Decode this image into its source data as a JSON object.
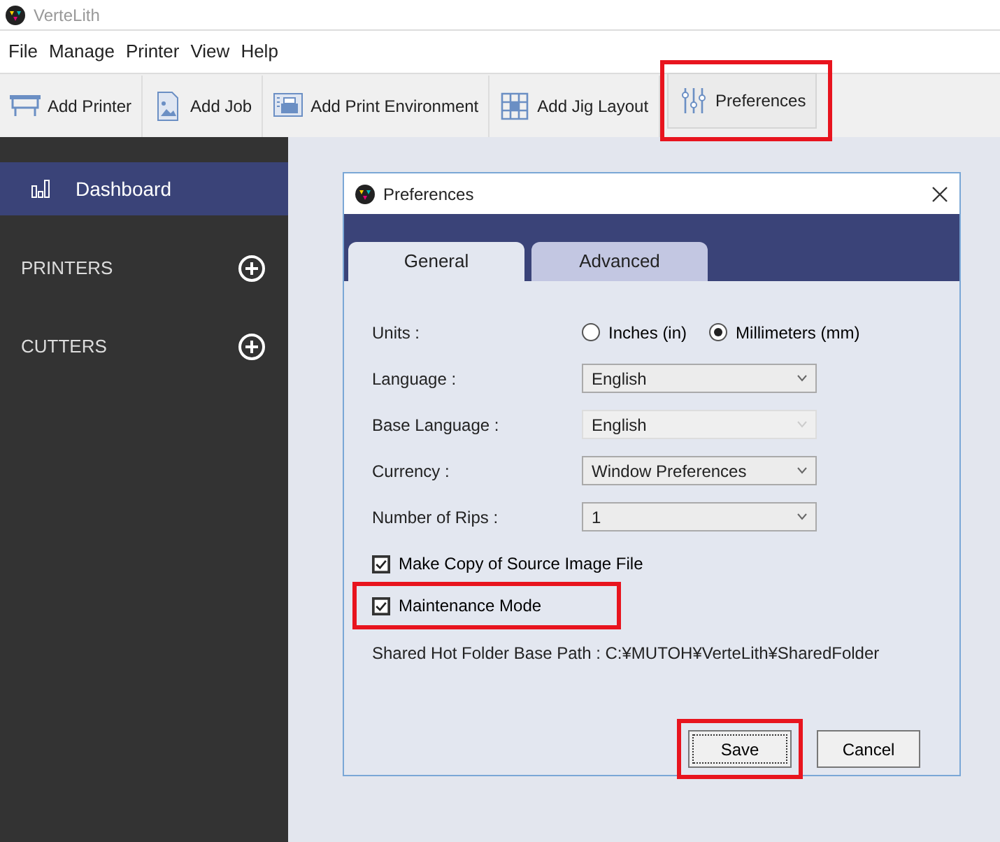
{
  "window": {
    "title": "VerteLith"
  },
  "menu": [
    "File",
    "Manage",
    "Printer",
    "View",
    "Help"
  ],
  "toolbar": [
    {
      "label": "Add Printer",
      "kind": "printer",
      "highlight": false
    },
    {
      "label": "Add Job",
      "kind": "job",
      "highlight": false
    },
    {
      "label": "Add Print Environment",
      "kind": "environment",
      "highlight": false
    },
    {
      "label": "Add Jig Layout",
      "kind": "jig",
      "highlight": false
    },
    {
      "label": "Preferences",
      "kind": "sliders",
      "highlight": true
    }
  ],
  "sidebar": {
    "items": [
      {
        "label": "Dashboard",
        "kind": "nav",
        "selected": true
      },
      {
        "label": "PRINTERS",
        "kind": "section",
        "selected": false
      },
      {
        "label": "CUTTERS",
        "kind": "section",
        "selected": false
      }
    ]
  },
  "dialog": {
    "title": "Preferences",
    "tabs": [
      {
        "label": "General",
        "selected": true
      },
      {
        "label": "Advanced",
        "selected": false
      }
    ],
    "units": {
      "label": "Units :",
      "options": [
        {
          "label": "Inches (in)",
          "selected": false
        },
        {
          "label": "Millimeters (mm)",
          "selected": true
        }
      ]
    },
    "dropdowns": [
      {
        "label": "Language :",
        "value": "English",
        "disabled": false
      },
      {
        "label": "Base Language :",
        "value": "English",
        "disabled": true
      },
      {
        "label": "Currency :",
        "value": "Window Preferences",
        "disabled": false
      },
      {
        "label": "Number of Rips :",
        "value": "1",
        "disabled": false
      }
    ],
    "checkboxes": [
      {
        "label": "Make Copy of Source Image File",
        "checked": true,
        "highlight": false
      },
      {
        "label": "Maintenance Mode",
        "checked": true,
        "highlight": true
      }
    ],
    "path_label": "Shared Hot Folder Base Path : C:¥MUTOH¥VerteLith¥SharedFolder",
    "buttons": [
      {
        "label": "Save",
        "highlight": true
      },
      {
        "label": "Cancel",
        "highlight": false
      }
    ]
  }
}
